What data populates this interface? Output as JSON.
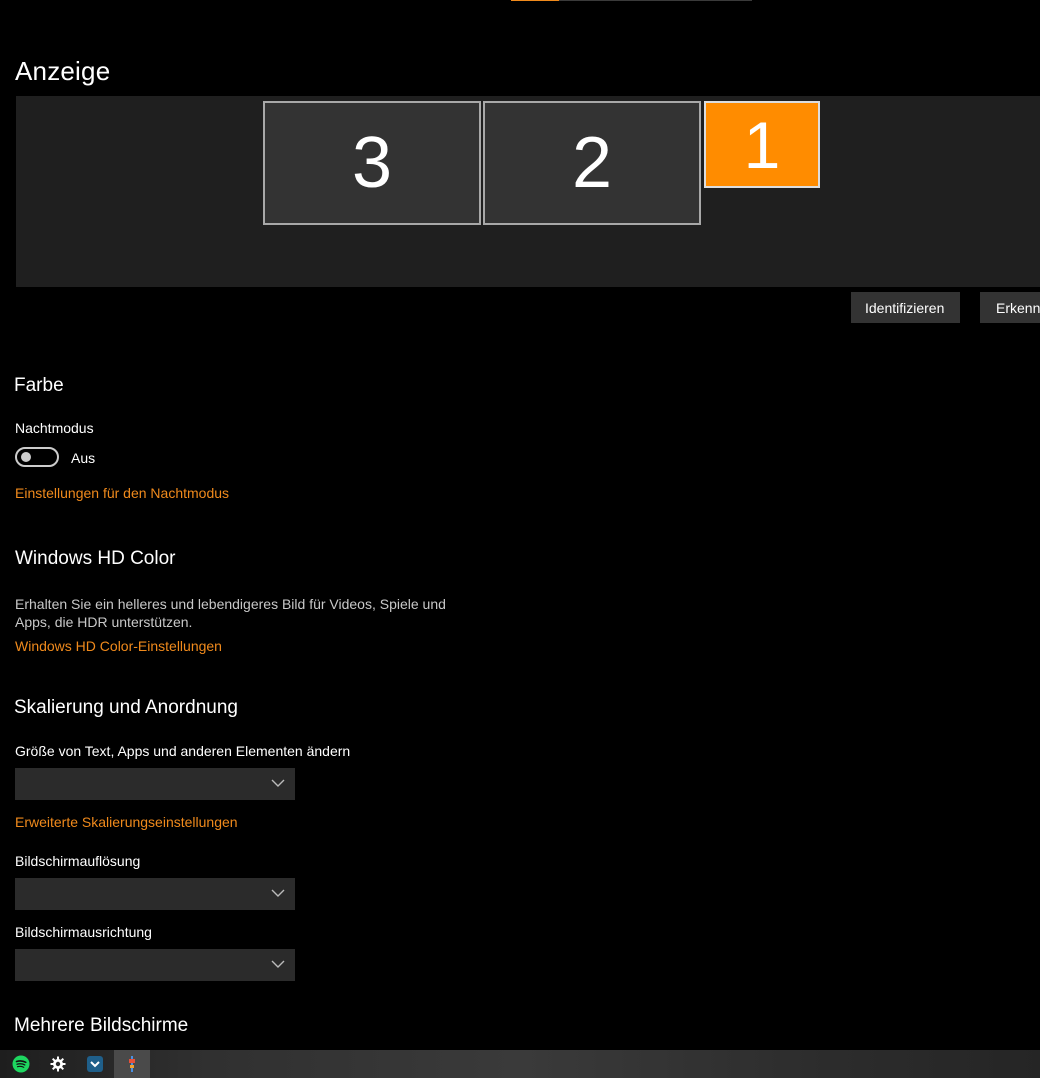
{
  "page": {
    "title": "Anzeige"
  },
  "arrangement": {
    "monitors": [
      {
        "label": "3",
        "selected": false
      },
      {
        "label": "2",
        "selected": false
      },
      {
        "label": "1",
        "selected": true
      }
    ],
    "accent_color": "#ff8c00"
  },
  "buttons": {
    "identify": "Identifizieren",
    "detect": "Erkennen"
  },
  "color": {
    "heading": "Farbe",
    "night_mode_label": "Nachtmodus",
    "night_mode_state": "Aus",
    "night_mode_on": false,
    "night_mode_link": "Einstellungen für den Nachtmodus"
  },
  "hd_color": {
    "heading": "Windows HD Color",
    "description": "Erhalten Sie ein helleres und lebendigeres Bild für Videos, Spiele und Apps, die HDR unterstützen.",
    "link": "Windows HD Color-Einstellungen"
  },
  "scale": {
    "heading": "Skalierung und Anordnung",
    "size_label": "Größe von Text, Apps und anderen Elementen ändern",
    "size_value": "",
    "advanced_link": "Erweiterte Skalierungseinstellungen",
    "resolution_label": "Bildschirmauflösung",
    "resolution_value": "",
    "orientation_label": "Bildschirmausrichtung",
    "orientation_value": ""
  },
  "multi": {
    "heading": "Mehrere Bildschirme"
  },
  "taskbar": {
    "icons": [
      "spotify-icon",
      "settings-gear-icon",
      "chevron-app-icon",
      "pinned-app-icon"
    ]
  },
  "colors": {
    "accent": "#f08a1c",
    "background": "#000000",
    "panel": "#1f1f1f"
  }
}
